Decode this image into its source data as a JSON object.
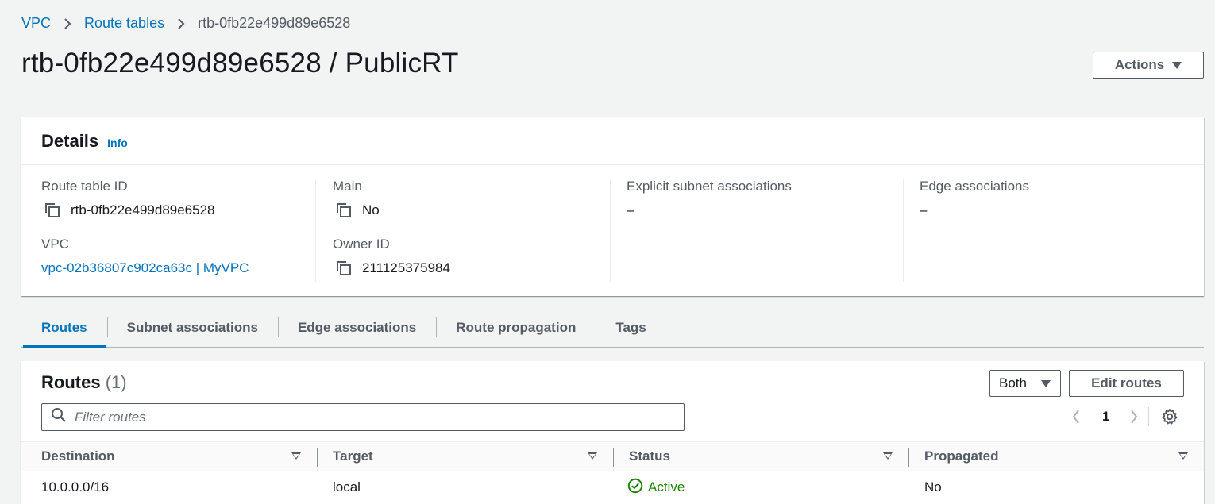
{
  "breadcrumb": {
    "items": [
      "VPC",
      "Route tables"
    ],
    "current": "rtb-0fb22e499d89e6528"
  },
  "page_title": "rtb-0fb22e499d89e6528 / PublicRT",
  "actions_label": "Actions",
  "details": {
    "title": "Details",
    "info_label": "Info",
    "route_table_id_label": "Route table ID",
    "route_table_id": "rtb-0fb22e499d89e6528",
    "vpc_label": "VPC",
    "vpc_value": "vpc-02b36807c902ca63c | MyVPC",
    "main_label": "Main",
    "main_value": "No",
    "owner_id_label": "Owner ID",
    "owner_id": "211125375984",
    "explicit_subnet_label": "Explicit subnet associations",
    "explicit_subnet_value": "–",
    "edge_assoc_label": "Edge associations",
    "edge_assoc_value": "–"
  },
  "tabs": [
    "Routes",
    "Subnet associations",
    "Edge associations",
    "Route propagation",
    "Tags"
  ],
  "routes": {
    "title": "Routes",
    "count": "(1)",
    "filter_select": "Both",
    "edit_label": "Edit routes",
    "filter_placeholder": "Filter routes",
    "page": "1",
    "columns": [
      "Destination",
      "Target",
      "Status",
      "Propagated"
    ],
    "rows": [
      {
        "destination": "10.0.0.0/16",
        "target": "local",
        "status": "Active",
        "propagated": "No"
      }
    ]
  },
  "colors": {
    "link": "#0073bb",
    "success": "#1d8102",
    "background": "#f2f3f3"
  },
  "icons": [
    "chevron-right-icon",
    "copy-icon",
    "caret-down-icon",
    "search-icon",
    "chevron-left-icon",
    "settings-gear-icon",
    "status-success-icon",
    "sort-icon"
  ]
}
